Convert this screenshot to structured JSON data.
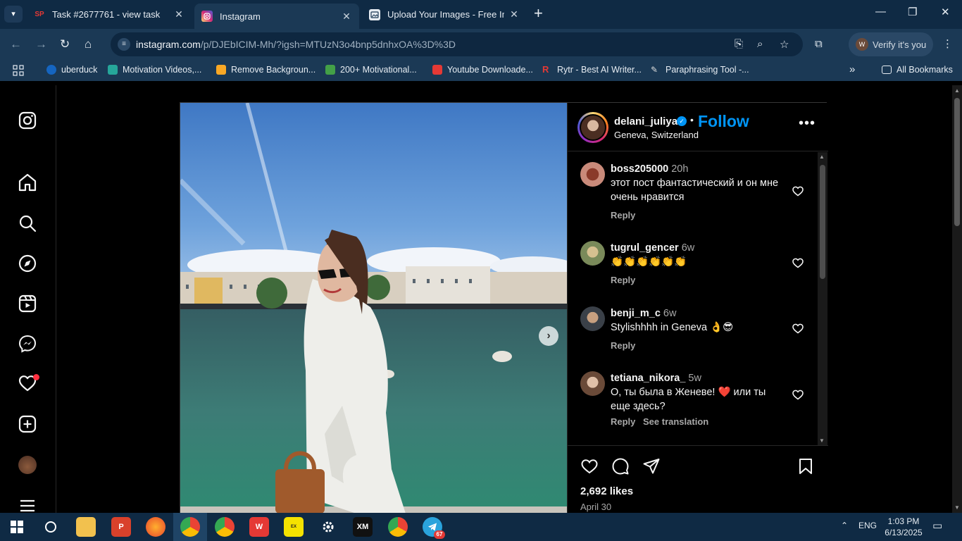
{
  "browser": {
    "tabs": [
      {
        "label": "Task #2677761 - view task",
        "favicon": "SP",
        "active": false
      },
      {
        "label": "Instagram",
        "favicon": "instagram-icon",
        "active": true
      },
      {
        "label": "Upload Your Images - Free Imag",
        "favicon": "upload-icon",
        "active": false
      }
    ],
    "url_host": "instagram.com",
    "url_path": "/p/DJEbICIM-Mh/?igsh=MTUzN3o4bnp5dnhxOA%3D%3D",
    "verify_label": "Verify it's you",
    "verify_avatar": "W",
    "bookmarks": [
      {
        "label": "uberduck",
        "color": "#1565c0"
      },
      {
        "label": "Motivation Videos,...",
        "color": "#26a69a"
      },
      {
        "label": "Remove Backgroun...",
        "color": "#f9a825"
      },
      {
        "label": "200+ Motivational...",
        "color": "#43a047"
      },
      {
        "label": "Youtube Downloade...",
        "color": "#e53935"
      },
      {
        "label": "Rytr - Best AI Writer...",
        "color": "#e53935"
      },
      {
        "label": "Paraphrasing Tool -...",
        "color": "#9e9e9e"
      }
    ],
    "all_bookmarks_label": "All Bookmarks"
  },
  "post": {
    "username": "delani_juliya",
    "follow_label": "Follow",
    "location": "Geneva, Switzerland",
    "likes": "2,692 likes",
    "date": "April 30",
    "comments": [
      {
        "user": "boss205000",
        "time": "20h",
        "text": "этот пост фантастический и он мне очень нравится",
        "reply": "Reply",
        "translation": ""
      },
      {
        "user": "tugrul_gencer",
        "time": "6w",
        "text": "👏👏👏👏👏👏",
        "reply": "Reply",
        "translation": ""
      },
      {
        "user": "benji_m_c",
        "time": "6w",
        "text": "Stylishhhh in Geneva 👌😎",
        "reply": "Reply",
        "translation": ""
      },
      {
        "user": "tetiana_nikora_",
        "time": "5w",
        "text": "О, ты была в Женеве! ❤️ или ты еще здесь?",
        "reply": "Reply",
        "translation": "See translation"
      }
    ]
  },
  "taskbar": {
    "language": "ENG",
    "time": "1:03 PM",
    "date": "6/13/2025",
    "telegram_badge": "67"
  }
}
